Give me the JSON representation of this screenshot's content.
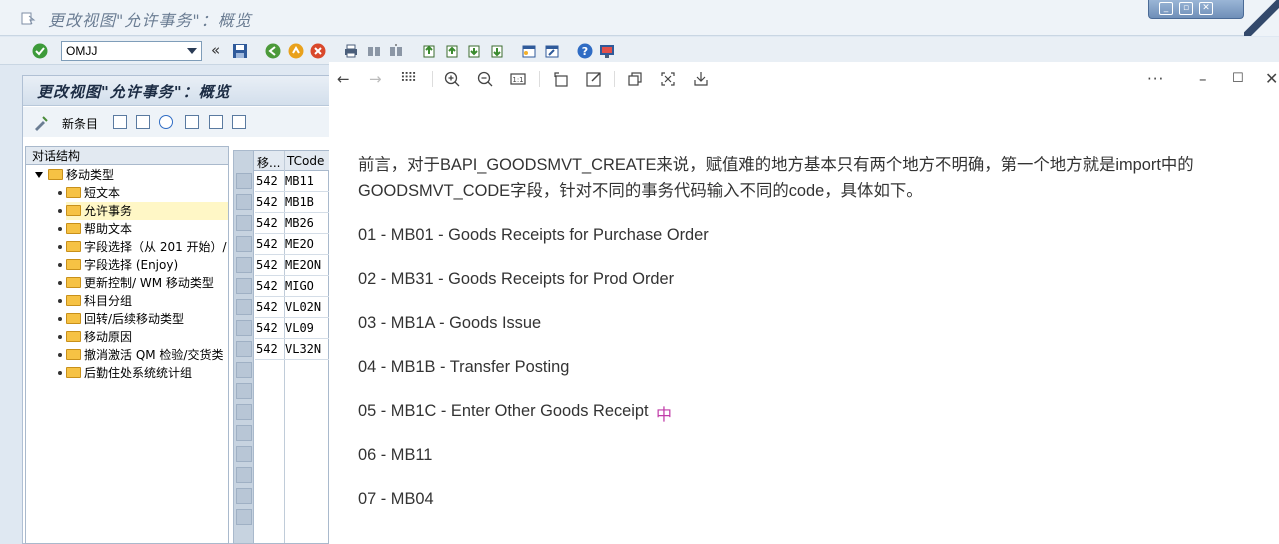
{
  "window": {
    "title": "更改视图\"允许事务\"：概览",
    "controls": [
      "minimize",
      "maximize",
      "close"
    ]
  },
  "toolbar": {
    "command_value": "OMJJ",
    "back_glyph": "«",
    "icons": [
      "enter-icon",
      "save-icon",
      "back-icon",
      "exit-icon",
      "cancel-icon",
      "print-icon",
      "find-icon",
      "find-next-icon",
      "first-page-icon",
      "prev-page-icon",
      "next-page-icon",
      "last-page-icon",
      "new-session-icon",
      "shortcut-icon",
      "help-icon",
      "customize-icon"
    ]
  },
  "panel": {
    "title": "更改视图\"允许事务\"：概览",
    "new_entries_label": "新条目"
  },
  "tree": {
    "header": "对话结构",
    "root": "移动类型",
    "items": [
      {
        "label": "短文本",
        "selected": false
      },
      {
        "label": "允许事务",
        "selected": true
      },
      {
        "label": "帮助文本",
        "selected": false
      },
      {
        "label": "字段选择（从 201 开始）/",
        "selected": false
      },
      {
        "label": "字段选择 (Enjoy)",
        "selected": false
      },
      {
        "label": "更新控制/ WM 移动类型",
        "selected": false
      },
      {
        "label": "科目分组",
        "selected": false
      },
      {
        "label": "回转/后续移动类型",
        "selected": false
      },
      {
        "label": "移动原因",
        "selected": false
      },
      {
        "label": "撤消激活 QM 检验/交货类",
        "selected": false
      },
      {
        "label": "后勤住处系统统计组",
        "selected": false
      }
    ]
  },
  "table": {
    "headers": [
      "移...",
      "TCode"
    ],
    "rows": [
      {
        "mvt": "542",
        "tcode": "MB11"
      },
      {
        "mvt": "542",
        "tcode": "MB1B"
      },
      {
        "mvt": "542",
        "tcode": "MB26"
      },
      {
        "mvt": "542",
        "tcode": "ME2O"
      },
      {
        "mvt": "542",
        "tcode": "ME2ON"
      },
      {
        "mvt": "542",
        "tcode": "MIGO"
      },
      {
        "mvt": "542",
        "tcode": "VL02N"
      },
      {
        "mvt": "542",
        "tcode": "VL09"
      },
      {
        "mvt": "542",
        "tcode": "VL32N"
      }
    ]
  },
  "viewer": {
    "toolbar_icons": [
      "back-arrow-icon",
      "forward-arrow-icon",
      "grid-icon",
      "zoom-in-icon",
      "zoom-out-icon",
      "actual-size-icon",
      "rotate-icon",
      "edit-icon",
      "copy-icon",
      "crop-icon",
      "save-icon",
      "more-icon",
      "minimize-icon",
      "maximize-icon",
      "close-icon"
    ],
    "paragraphs": [
      "前言，对于BAPI_GOODSMVT_CREATE来说，赋值难的地方基本只有两个地方不明确，第一个地方就是import中的",
      "GOODSMVT_CODE字段，针对不同的事务代码输入不同的code，具体如下。",
      "01 - MB01 - Goods Receipts for Purchase Order",
      "02 - MB31 - Goods Receipts for Prod Order",
      "03 - MB1A - Goods Issue",
      "04 - MB1B - Transfer Posting",
      "05 - MB1C - Enter Other Goods Receipt",
      "06 - MB11",
      "07 - MB04"
    ],
    "cursor_glyph": "中"
  }
}
